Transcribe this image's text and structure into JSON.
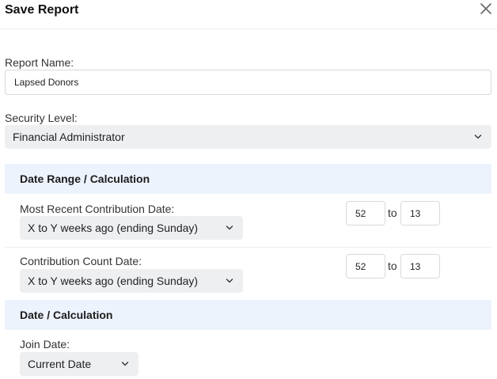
{
  "dialog": {
    "title": "Save Report"
  },
  "report_name": {
    "label": "Report Name:",
    "value": "Lapsed Donors"
  },
  "security_level": {
    "label": "Security Level:",
    "selected": "Financial Administrator"
  },
  "sections": {
    "date_range": {
      "heading": "Date Range / Calculation"
    },
    "date": {
      "heading": "Date / Calculation"
    }
  },
  "rows": {
    "most_recent": {
      "label": "Most Recent Contribution Date:",
      "selected": "X to Y weeks ago (ending Sunday)",
      "from": "52",
      "to_word": "to",
      "to": "13"
    },
    "count": {
      "label": "Contribution Count Date:",
      "selected": "X to Y weeks ago (ending Sunday)",
      "from": "52",
      "to_word": "to",
      "to": "13"
    },
    "join": {
      "label": "Join Date:",
      "selected": "Current Date"
    }
  },
  "icons": {
    "close": "close-icon",
    "chevron": "chevron-down-icon"
  },
  "colors": {
    "section_bg": "#edf3fc",
    "select_bg": "#eeeff1",
    "border": "#d6d9de"
  }
}
